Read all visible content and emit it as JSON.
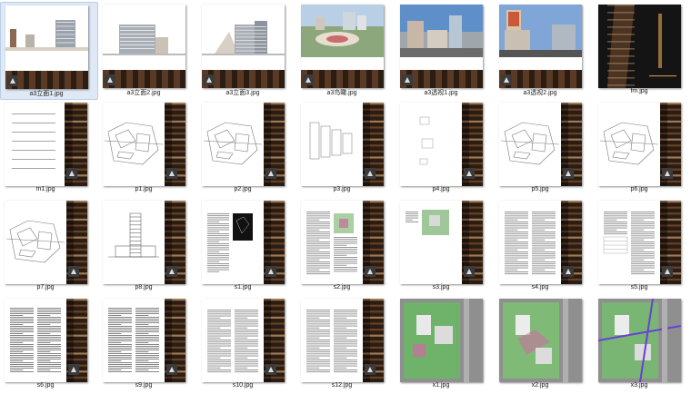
{
  "files": [
    {
      "name": "a3立面1.jpg",
      "kind": "elev1",
      "selected": true
    },
    {
      "name": "a3立面2.jpg",
      "kind": "elev2"
    },
    {
      "name": "a3立面3.jpg",
      "kind": "elev3"
    },
    {
      "name": "a3鸟瞰.jpg",
      "kind": "aerial"
    },
    {
      "name": "a3透视1.jpg",
      "kind": "persp1"
    },
    {
      "name": "a3透视2.jpg",
      "kind": "persp2"
    },
    {
      "name": "fm.jpg",
      "kind": "cover"
    },
    {
      "name": "m1.jpg",
      "kind": "toc"
    },
    {
      "name": "p1.jpg",
      "kind": "plan"
    },
    {
      "name": "p2.jpg",
      "kind": "plan"
    },
    {
      "name": "p3.jpg",
      "kind": "plan2"
    },
    {
      "name": "p4.jpg",
      "kind": "plan3"
    },
    {
      "name": "p5.jpg",
      "kind": "plan"
    },
    {
      "name": "p6.jpg",
      "kind": "plan"
    },
    {
      "name": "p7.jpg",
      "kind": "plan"
    },
    {
      "name": "p8.jpg",
      "kind": "section"
    },
    {
      "name": "s1.jpg",
      "kind": "textdark"
    },
    {
      "name": "s2.jpg",
      "kind": "textgreen"
    },
    {
      "name": "s3.jpg",
      "kind": "smallmap"
    },
    {
      "name": "s4.jpg",
      "kind": "text"
    },
    {
      "name": "s5.jpg",
      "kind": "texttable"
    },
    {
      "name": "s6.jpg",
      "kind": "textdense"
    },
    {
      "name": "s9.jpg",
      "kind": "textdense"
    },
    {
      "name": "s10.jpg",
      "kind": "text"
    },
    {
      "name": "s12.jpg",
      "kind": "text"
    },
    {
      "name": "x1.jpg",
      "kind": "site1"
    },
    {
      "name": "x2.jpg",
      "kind": "site2"
    },
    {
      "name": "x3.jpg",
      "kind": "site3"
    }
  ],
  "colors": {
    "stripe_dark": "#2b1d12",
    "stripe_mid": "#7a4f31",
    "stripe_light": "#c89a6b",
    "site_green": "#6fb36a",
    "site_grey": "#8f8f8f",
    "sky": "#5f8fc9",
    "selection": "#dfe9f5"
  }
}
